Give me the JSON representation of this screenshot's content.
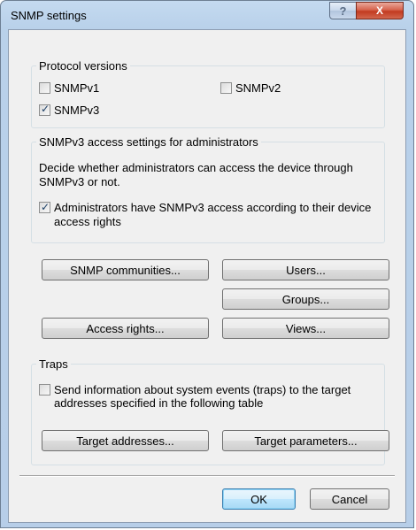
{
  "window": {
    "title": "SNMP settings"
  },
  "titlebar": {
    "help_label": "?",
    "close_label": "X"
  },
  "protocol_versions": {
    "label": "Protocol versions",
    "snmpv1": {
      "label": "SNMPv1",
      "checked": false
    },
    "snmpv2": {
      "label": "SNMPv2",
      "checked": false
    },
    "snmpv3": {
      "label": "SNMPv3",
      "checked": true
    }
  },
  "access_settings": {
    "label": "SNMPv3 access settings for administrators",
    "description": "Decide whether administrators can access the device through SNMPv3 or not.",
    "admin_access": {
      "label": "Administrators have SNMPv3 access according to their device access rights",
      "checked": true
    }
  },
  "buttons": {
    "snmp_communities": "SNMP communities...",
    "users": "Users...",
    "groups": "Groups...",
    "access_rights": "Access rights...",
    "views": "Views..."
  },
  "traps": {
    "label": "Traps",
    "send_info": {
      "label": "Send information about system events (traps) to the target addresses specified in the following table",
      "checked": false
    },
    "target_addresses": "Target addresses...",
    "target_parameters": "Target parameters..."
  },
  "footer": {
    "ok_label": "OK",
    "cancel_label": "Cancel"
  }
}
